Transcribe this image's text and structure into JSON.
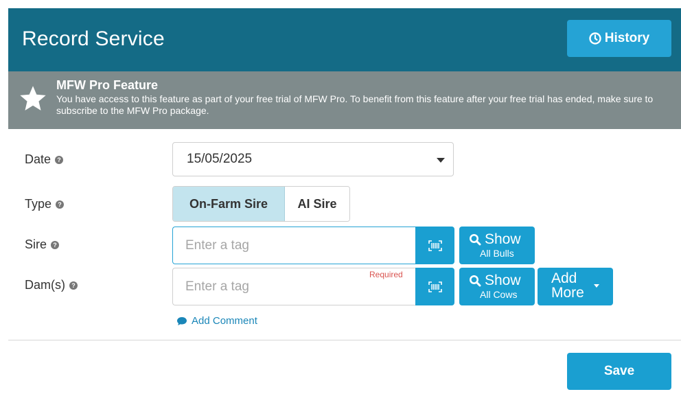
{
  "header": {
    "title": "Record Service",
    "history_label": "History",
    "history_icon": "clock-icon"
  },
  "pro_banner": {
    "icon": "star-icon",
    "title": "MFW Pro Feature",
    "text": "You have access to this feature as part of your free trial of MFW Pro. To benefit from this feature after your free trial has ended, make sure to subscribe to the MFW Pro package."
  },
  "form": {
    "date": {
      "label": "Date",
      "value": "15/05/2025"
    },
    "type": {
      "label": "Type",
      "options": [
        "On-Farm Sire",
        "AI Sire"
      ],
      "selected": "On-Farm Sire"
    },
    "sire": {
      "label": "Sire",
      "placeholder": "Enter a tag",
      "value": "",
      "show_label": "Show",
      "show_sub": "All Bulls"
    },
    "dams": {
      "label": "Dam(s)",
      "placeholder": "Enter a tag",
      "value": "",
      "required_text": "Required",
      "show_label": "Show",
      "show_sub": "All Cows",
      "add_more_line1": "Add",
      "add_more_line2": "More"
    },
    "add_comment": "Add Comment",
    "help_glyph": "?"
  },
  "footer": {
    "save_label": "Save"
  },
  "colors": {
    "header_bg": "#146b86",
    "accent": "#1a9fd1",
    "banner_bg": "#7f8b8c",
    "toggle_active": "#c3e4ee",
    "required": "#d9534f"
  }
}
